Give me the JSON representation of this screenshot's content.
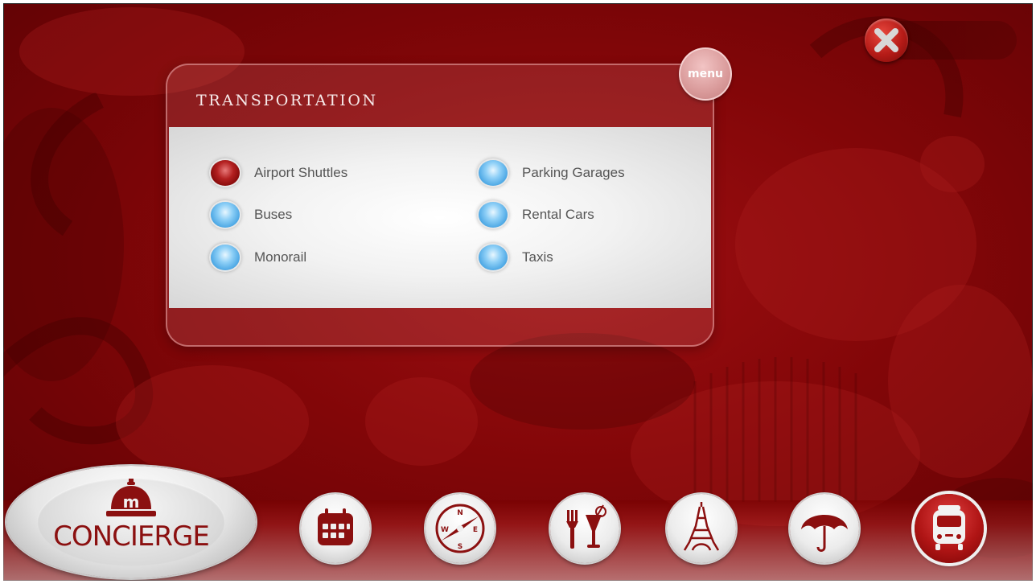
{
  "panel": {
    "title": "TRANSPORTATION",
    "menu_label": "menu",
    "options": [
      {
        "label": "Airport Shuttles",
        "selected": true
      },
      {
        "label": "Buses",
        "selected": false
      },
      {
        "label": "Monorail",
        "selected": false
      },
      {
        "label": "Parking Garages",
        "selected": false
      },
      {
        "label": "Rental Cars",
        "selected": false
      },
      {
        "label": "Taxis",
        "selected": false
      }
    ]
  },
  "dock": {
    "concierge_label": "CONCIERGE",
    "buttons": [
      {
        "icon": "calendar-icon"
      },
      {
        "icon": "compass-icon"
      },
      {
        "icon": "dining-icon"
      },
      {
        "icon": "eiffel-tower-icon"
      },
      {
        "icon": "umbrella-icon"
      },
      {
        "icon": "bus-icon",
        "active": true
      }
    ]
  },
  "colors": {
    "background": "#820608",
    "accent": "#8b1010",
    "radio": "#3d9ee0",
    "radio_selected": "#7d0707"
  }
}
